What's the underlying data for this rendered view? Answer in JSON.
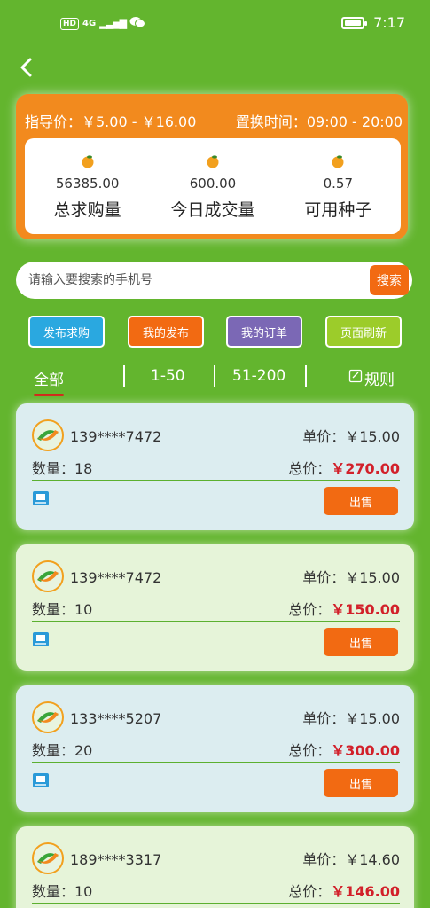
{
  "status_bar": {
    "network": "4G",
    "hd": "HD",
    "time": "7:17",
    "battery_level": 0.8
  },
  "summary": {
    "guide_price": "指导价：￥5.00 - ￥16.00",
    "exchange_time": "置换时间：09:00 - 20:00",
    "stats": [
      {
        "value": "56385.00",
        "label": "总求购量"
      },
      {
        "value": "600.00",
        "label": "今日成交量"
      },
      {
        "value": "0.57",
        "label": "可用种子"
      }
    ]
  },
  "search": {
    "placeholder": "请输入要搜索的手机号",
    "value": "",
    "button": "搜索"
  },
  "actions": [
    {
      "label": "发布求购",
      "color": "#2aa8e0"
    },
    {
      "label": "我的发布",
      "color": "#f26a12"
    },
    {
      "label": "我的订单",
      "color": "#7b68b5"
    },
    {
      "label": "页面刷新",
      "color": "#9ccc2a"
    }
  ],
  "tabs": [
    "全部",
    "1-50",
    "51-200"
  ],
  "rules_label": "规则",
  "orders": [
    {
      "phone": "139****7472",
      "price": "单价：￥15.00",
      "qty": "数量：18",
      "total_label": "总价：",
      "total": "￥270.00",
      "sell": "出售",
      "bg": "#dcedf0"
    },
    {
      "phone": "139****7472",
      "price": "单价：￥15.00",
      "qty": "数量：10",
      "total_label": "总价：",
      "total": "￥150.00",
      "sell": "出售",
      "bg": "#e6f4d9"
    },
    {
      "phone": "133****5207",
      "price": "单价：￥15.00",
      "qty": "数量：20",
      "total_label": "总价：",
      "total": "￥300.00",
      "sell": "出售",
      "bg": "#dcedf0"
    },
    {
      "phone": "189****3317",
      "price": "单价：￥14.60",
      "qty": "数量：10",
      "total_label": "总价：",
      "total": "￥146.00",
      "sell": "出售",
      "bg": "#e6f4d9"
    }
  ],
  "colors": {
    "background": "#63b52e",
    "accent_orange": "#f28a1e",
    "price_red": "#d2202a"
  }
}
